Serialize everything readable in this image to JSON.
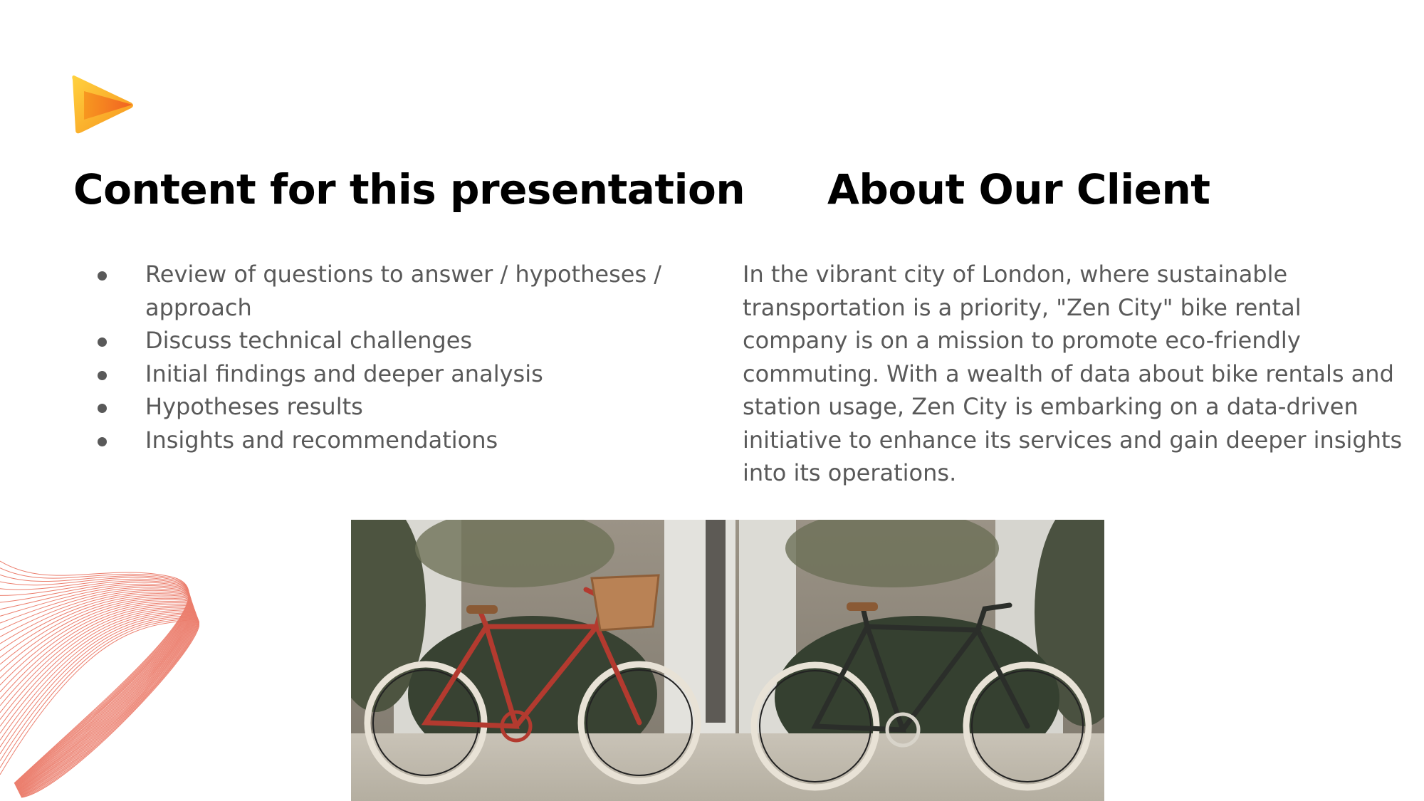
{
  "slide": {
    "left_heading": "Content for this presentation",
    "right_heading": "About Our Client",
    "bullets": [
      "Review of questions to answer / hypotheses / approach",
      "Discuss technical challenges",
      "Initial findings and deeper analysis",
      "Hypotheses results",
      "Insights and recommendations"
    ],
    "about_text": "In the vibrant city of London, where sustainable transportation is a priority, \"Zen City\" bike rental company is on a mission to promote eco-friendly commuting. With a wealth of data about bike rentals and station usage, Zen City is embarking on a data-driven initiative to enhance its services and gain deeper insights into its operations."
  },
  "icons": {
    "logo": "play-triangle-logo-icon",
    "bullet": "bullet-dot-icon"
  },
  "colors": {
    "heading": "#000000",
    "body_text": "#595959",
    "logo_yellow": "#FFC21A",
    "logo_orange": "#F36B21",
    "wave_line": "#E5533D"
  }
}
